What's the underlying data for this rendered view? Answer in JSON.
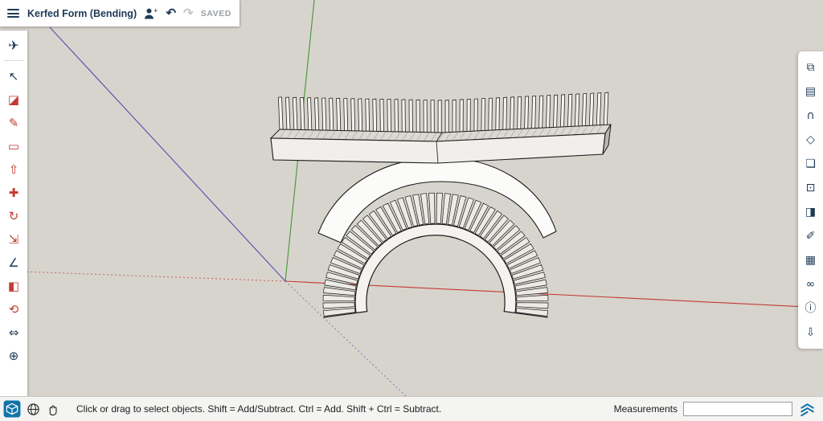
{
  "header": {
    "title": "Kerfed Form (Bending)",
    "saved_status": "SAVED",
    "undo_glyph": "↶",
    "redo_glyph": "↷",
    "icons": [
      "menu",
      "add-collaborator",
      "undo",
      "redo"
    ]
  },
  "left_toolbar": {
    "top_tool": {
      "id": "share",
      "glyph": "✈"
    },
    "tools": [
      {
        "id": "select",
        "glyph": "↖",
        "color": "navy"
      },
      {
        "id": "eraser",
        "glyph": "◪",
        "color": "red"
      },
      {
        "id": "freehand",
        "glyph": "✎",
        "color": "red"
      },
      {
        "id": "shapes",
        "glyph": "▭",
        "color": "red"
      },
      {
        "id": "push-pull",
        "glyph": "⇧",
        "color": "red"
      },
      {
        "id": "move",
        "glyph": "✚",
        "color": "red"
      },
      {
        "id": "rotate",
        "glyph": "↻",
        "color": "red"
      },
      {
        "id": "scale",
        "glyph": "⇲",
        "color": "red"
      },
      {
        "id": "tape-measure",
        "glyph": "∠",
        "color": "navy"
      },
      {
        "id": "paint",
        "glyph": "◧",
        "color": "red"
      },
      {
        "id": "orbit",
        "glyph": "⟲",
        "color": "red"
      },
      {
        "id": "pan",
        "glyph": "⇔",
        "color": "navy"
      },
      {
        "id": "zoom",
        "glyph": "⊕",
        "color": "navy"
      }
    ]
  },
  "right_panel": {
    "tools": [
      {
        "id": "entity-info",
        "glyph": "⧉"
      },
      {
        "id": "outliner",
        "glyph": "▤"
      },
      {
        "id": "instructor",
        "glyph": "∩"
      },
      {
        "id": "soften-edges",
        "glyph": "◇"
      },
      {
        "id": "components",
        "glyph": "❏"
      },
      {
        "id": "3d-warehouse",
        "glyph": "⊡"
      },
      {
        "id": "materials",
        "glyph": "◨"
      },
      {
        "id": "styles",
        "glyph": "✐"
      },
      {
        "id": "scenes",
        "glyph": "▦"
      },
      {
        "id": "display",
        "glyph": "∞"
      },
      {
        "id": "model-info",
        "glyph": "ⓘ"
      },
      {
        "id": "export",
        "glyph": "⇩"
      }
    ]
  },
  "statusbar": {
    "hint": "Click or drag to select objects. Shift = Add/Subtract. Ctrl = Add. Shift + Ctrl = Subtract.",
    "measurements_label": "Measurements",
    "measurements_value": "",
    "icons": [
      "sketchup-model",
      "globe",
      "hand",
      "sketchup-logo"
    ]
  },
  "canvas": {
    "background": "#d7d4cd",
    "axis_colors": {
      "red": "#c43a35",
      "green": "#4e9a43",
      "blue": "#5a57b0"
    },
    "model_colors": {
      "fill": "#f2f1ed",
      "outline": "#1a1a1a"
    }
  }
}
